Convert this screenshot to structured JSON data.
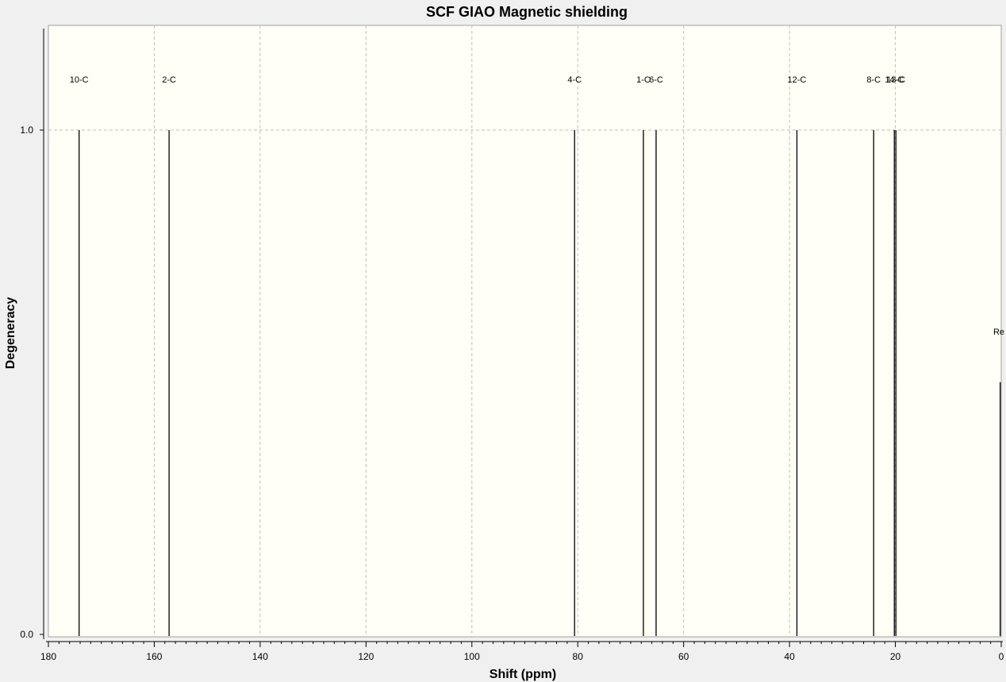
{
  "chart_data": {
    "type": "bar",
    "title": "SCF GIAO Magnetic shielding",
    "xlabel": "Shift (ppm)",
    "ylabel": "Degeneracy",
    "xlim": [
      180,
      0
    ],
    "x_reversed": true,
    "ylim": [
      0,
      1.0
    ],
    "x_ticks": [
      "180",
      "160",
      "140",
      "120",
      "100",
      "80",
      "60",
      "40",
      "20",
      "0"
    ],
    "y_ticks": [
      "0.0",
      "1.0"
    ],
    "grid": true,
    "peaks": [
      {
        "label": "10-C",
        "shift": 174.2,
        "degeneracy": 1.0
      },
      {
        "label": "2-C",
        "shift": 157.2,
        "degeneracy": 1.0
      },
      {
        "label": "4-C",
        "shift": 80.6,
        "degeneracy": 1.0
      },
      {
        "label": "1-C",
        "shift": 67.6,
        "degeneracy": 1.0
      },
      {
        "label": "6-C",
        "shift": 65.2,
        "degeneracy": 1.0
      },
      {
        "label": "12-C",
        "shift": 38.6,
        "degeneracy": 1.0
      },
      {
        "label": "8-C",
        "shift": 24.1,
        "degeneracy": 1.0
      },
      {
        "label": "14-C",
        "shift": 20.2,
        "degeneracy": 1.0
      },
      {
        "label": "13-C",
        "shift": 19.9,
        "degeneracy": 1.0
      },
      {
        "label": "Re",
        "shift": 0.2,
        "degeneracy": 0.5
      }
    ],
    "colors": {
      "plot_background": "#fffff7",
      "outer_background": "#f0f0f0",
      "line": "#000000",
      "grid": "#bfbfbf"
    }
  }
}
